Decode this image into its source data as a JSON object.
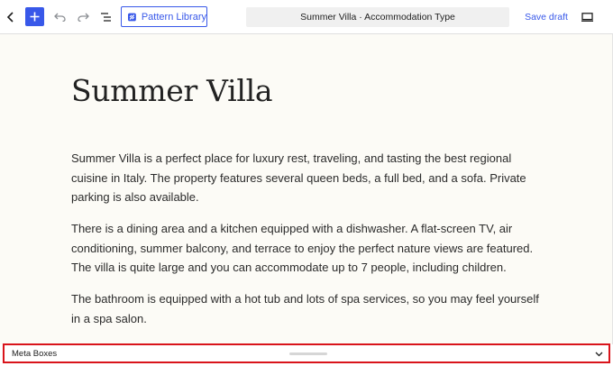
{
  "toolbar": {
    "pattern_library_label": "Pattern Library",
    "document_title": "Summer Villa · Accommodation Type",
    "save_draft_label": "Save draft",
    "icons": {
      "back": "chevron-left-icon",
      "add": "plus-icon",
      "undo": "undo-icon",
      "redo": "redo-icon",
      "document_overview": "list-view-icon",
      "pattern_library": "pattern-library-logo-icon",
      "preview": "desktop-preview-icon"
    }
  },
  "content": {
    "title": "Summer Villa",
    "paragraphs": [
      "Summer Villa is a perfect place for luxury rest, traveling, and tasting the best regional cuisine in Italy. The property features several queen beds, a full bed, and a sofa. Private parking is also available.",
      "There is a dining area and a kitchen equipped with a dishwasher. A flat-screen TV, air conditioning, summer balcony, and terrace to enjoy the perfect nature views are featured. The villa is quite large and you can accommodate up to 7 people, including children.",
      "The bathroom is equipped with a hot tub and lots of spa services, so you may feel yourself in a spa salon."
    ]
  },
  "meta_boxes": {
    "label": "Meta Boxes",
    "toggle_icon": "chevron-down-icon",
    "highlight_color": "#d9141b"
  },
  "colors": {
    "accent": "#3858e9",
    "canvas_background": "#fcfbf6"
  }
}
